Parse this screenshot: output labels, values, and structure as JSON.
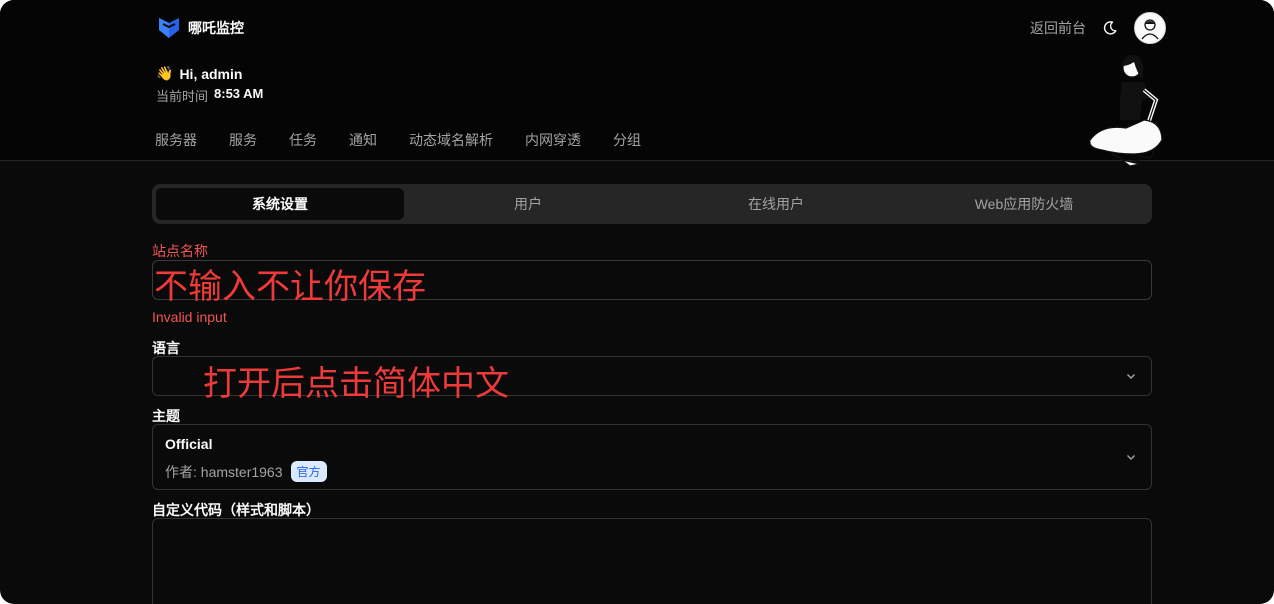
{
  "header": {
    "brand_name": "哪吒监控",
    "back_link": "返回前台",
    "greeting_wave": "👋",
    "greeting": "Hi, admin",
    "time_label": "当前时间",
    "time_value": "8:53 AM",
    "nav": [
      "服务器",
      "服务",
      "任务",
      "通知",
      "动态域名解析",
      "内网穿透",
      "分组"
    ],
    "icons": {
      "logo": "nezha-logo-icon",
      "theme_toggle": "moon-icon",
      "avatar": "user-avatar-icon"
    }
  },
  "tabs": [
    {
      "label": "系统设置",
      "active": true
    },
    {
      "label": "用户",
      "active": false
    },
    {
      "label": "在线用户",
      "active": false
    },
    {
      "label": "Web应用防火墙",
      "active": false
    }
  ],
  "form": {
    "site_name_label": "站点名称",
    "site_name_value": "",
    "site_name_error": "Invalid input",
    "language_label": "语言",
    "language_value": "",
    "theme_label": "主题",
    "theme_name": "Official",
    "theme_author": "作者: hamster1963",
    "theme_badge": "官方",
    "custom_code_label": "自定义代码（样式和脚本）",
    "custom_code_value": ""
  },
  "annotations": {
    "site_name_note": "不输入不让你保存",
    "language_note": "打开后点击简体中文"
  },
  "colors": {
    "background": "#0a0a0a",
    "error": "#f05656",
    "annotation": "#ef3a3a",
    "logo": "#2563eb",
    "badge_bg": "#dbeafe",
    "badge_text": "#2563eb"
  }
}
